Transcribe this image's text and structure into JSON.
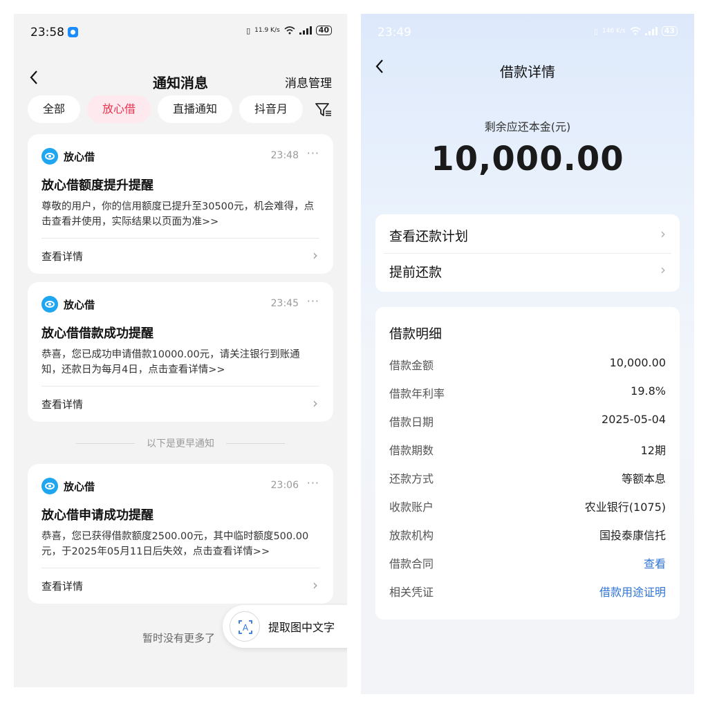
{
  "left": {
    "status": {
      "time": "23:58",
      "net_speed": "11.9 K/s",
      "battery": "40"
    },
    "nav": {
      "back": "<",
      "title": "通知消息",
      "action": "消息管理"
    },
    "chips": [
      "全部",
      "放心借",
      "直播通知",
      "抖音月"
    ],
    "cards": [
      {
        "app": "放心借",
        "time": "23:48",
        "more": "···",
        "title": "放心借额度提升提醒",
        "body": "尊敬的用户，你的信用额度已提升至30500元，机会难得，点击查看并使用，实际结果以页面为准>>",
        "link": "查看详情",
        "chevron": ">"
      },
      {
        "app": "放心借",
        "time": "23:45",
        "more": "···",
        "title": "放心借借款成功提醒",
        "body": "恭喜，您已成功申请借款10000.00元，请关注银行到账通知，还款日为每月4日，点击查看详情>>",
        "link": "查看详情",
        "chevron": ">"
      },
      {
        "app": "放心借",
        "time": "23:06",
        "more": "···",
        "title": "放心借申请成功提醒",
        "body": "恭喜，您已获得借款额度2500.00元，其中临时额度500.00元，于2025年05月11日后失效，点击查看详情>>",
        "link": "查看详情",
        "chevron": ">"
      }
    ],
    "earlier_divider": "以下是更早通知",
    "no_more": "暂时没有更多了",
    "ocr_button": "提取图中文字"
  },
  "right": {
    "status": {
      "time": "23:49",
      "net_speed": "146 K/s",
      "battery": "43"
    },
    "nav": {
      "back": "<",
      "title": "借款详情"
    },
    "amount_label": "剩余应还本金(元)",
    "amount": "10,000.00",
    "actions": [
      {
        "label": "查看还款计划",
        "chevron": ">"
      },
      {
        "label": "提前还款",
        "chevron": ">"
      }
    ],
    "detail_title": "借款明细",
    "details": [
      {
        "key": "借款金额",
        "value": "10,000.00"
      },
      {
        "key": "借款年利率",
        "value": "19.8%"
      },
      {
        "key": "借款日期",
        "value": "2025-05-04"
      },
      {
        "key": "借款期数",
        "value": "12期"
      },
      {
        "key": "还款方式",
        "value": "等额本息"
      },
      {
        "key": "收款账户",
        "value": "农业银行(1075)"
      },
      {
        "key": "放款机构",
        "value": "国投泰康信托"
      },
      {
        "key": "借款合同",
        "value": "查看"
      },
      {
        "key": "相关凭证",
        "value": "借款用途证明"
      }
    ]
  },
  "colors": {
    "accent_red": "#e8334f",
    "chip_active_bg": "#fde9ee",
    "link_blue": "#2f74d6",
    "brand_blue": "#1fa6f0"
  },
  "icons": [
    "back-arrow-icon",
    "filter-icon",
    "app-logo-icon",
    "more-icon",
    "chevron-right-icon",
    "ocr-scan-icon",
    "signal-icon",
    "wifi-icon",
    "battery-icon"
  ]
}
